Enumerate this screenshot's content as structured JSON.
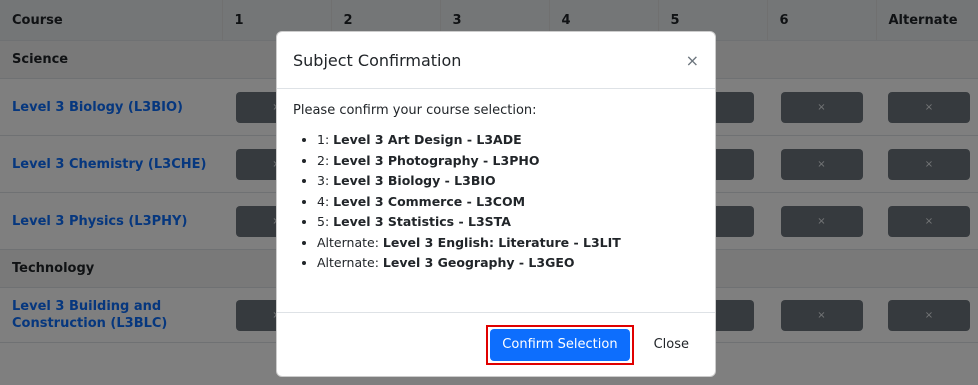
{
  "table": {
    "headers": [
      "Course",
      "1",
      "2",
      "3",
      "4",
      "5",
      "6",
      "Alternate"
    ],
    "sections": {
      "science": "Science",
      "technology": "Technology"
    },
    "courses": {
      "bio": "Level 3 Biology (L3BIO)",
      "che": "Level 3 Chemistry (L3CHE)",
      "phy": "Level 3 Physics (L3PHY)",
      "blc_line1": "Level 3 Building and",
      "blc_line2": "Construction (L3BLC)"
    },
    "cell_button_label": "×"
  },
  "modal": {
    "title": "Subject Confirmation",
    "close_icon": "×",
    "intro": "Please confirm your course selection:",
    "items": [
      {
        "prefix": "1: ",
        "value": "Level 3 Art Design - L3ADE"
      },
      {
        "prefix": "2: ",
        "value": "Level 3 Photography - L3PHO"
      },
      {
        "prefix": "3: ",
        "value": "Level 3 Biology - L3BIO"
      },
      {
        "prefix": "4: ",
        "value": "Level 3 Commerce - L3COM"
      },
      {
        "prefix": "5: ",
        "value": "Level 3 Statistics - L3STA"
      },
      {
        "prefix": "Alternate: ",
        "value": "Level 3 English: Literature - L3LIT"
      },
      {
        "prefix": "Alternate: ",
        "value": "Level 3 Geography - L3GEO"
      }
    ],
    "confirm_label": "Confirm Selection",
    "close_label": "Close"
  },
  "colors": {
    "primary": "#0d6efd",
    "button_gray": "#6c757d",
    "highlight": "#e00000"
  }
}
